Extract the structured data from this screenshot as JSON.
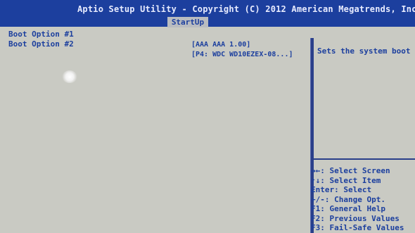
{
  "header": {
    "title": "Aptio Setup Utility - Copyright (C) 2012 American Megatrends, Inc.",
    "active_tab": "StartUp"
  },
  "boot_options": [
    {
      "label": "Boot Option #1",
      "value": "[AAA AAA 1.00]"
    },
    {
      "label": "Boot Option #2",
      "value": "[P4: WDC WD10EZEX-08...]"
    }
  ],
  "help": {
    "description": "Sets the system boot",
    "keys": [
      "→←: Select Screen",
      "↑↓: Select Item",
      "Enter: Select",
      "+/-: Change Opt.",
      "F1: General Help",
      "F2: Previous Values",
      "F3: Fail-Safe Values"
    ]
  },
  "colors": {
    "header_bg": "#1c3f9e",
    "body_bg": "#c9cac3",
    "text": "#1c3f9e"
  }
}
